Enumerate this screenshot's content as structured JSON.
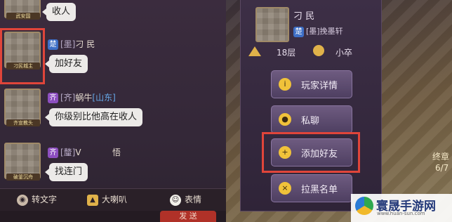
{
  "chat": {
    "messages": [
      {
        "name": "",
        "text": "收人",
        "avatar_tag": "武安国"
      },
      {
        "faction": "楚",
        "guild": "[墨]",
        "name": "刁 民",
        "place": "",
        "text": "加好友",
        "avatar_tag": "刁民城主"
      },
      {
        "faction": "齐",
        "guild": "[齐]",
        "name": "蜗牛",
        "place": "[山东]",
        "text": "你级别比他高在收人",
        "avatar_tag": "齐宣教头"
      },
      {
        "faction": "齐",
        "guild": "[釐]",
        "name": "V",
        "place": "",
        "suffix": "悟",
        "text": "找连门",
        "avatar_tag": "破釜沉舟"
      }
    ]
  },
  "toolbar": {
    "to_text_label": "转文字",
    "horn_label": "大喇叭",
    "emoji_label": "表情"
  },
  "send": {
    "label": "发 送"
  },
  "player_card": {
    "name": "刁 民",
    "faction": "楚",
    "guild": "[墨]挽墨轩",
    "floor": "18层",
    "rank": "小卒"
  },
  "menu": {
    "details_label": "玩家详情",
    "message_label": "私聊",
    "add_friend_label": "添加好友",
    "blacklist_label": "拉黑名单"
  },
  "scene": {
    "title": "终章",
    "progress": "6/7"
  },
  "watermark": {
    "brand": "寰晟手游网",
    "url": "www.huan-sun.com"
  },
  "colors": {
    "highlight": "#e0453a",
    "faction_blue": "#3e6fc7",
    "faction_purple": "#8d4fc0",
    "place_blue": "#66a8e8"
  }
}
